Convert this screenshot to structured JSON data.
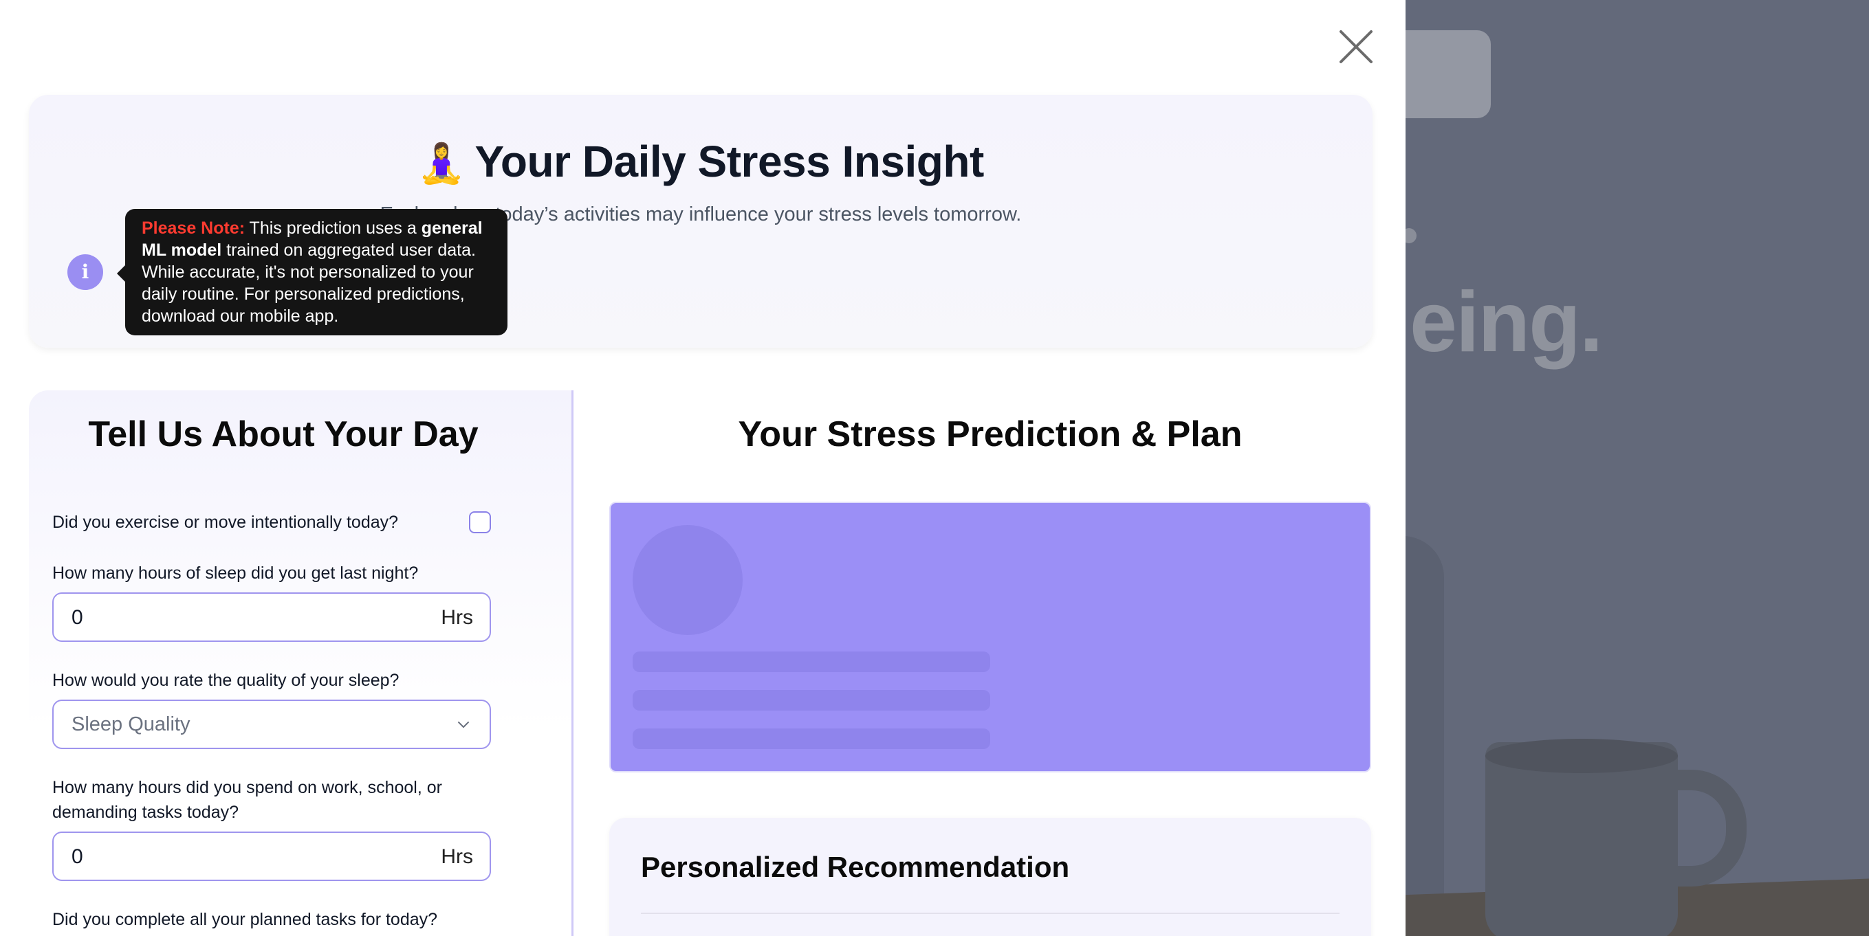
{
  "background": {
    "headline_fragment": "eing."
  },
  "modal": {
    "header": {
      "emoji": "🧘‍♀️",
      "title": "Your Daily Stress Insight",
      "subtitle": "Explore how today’s activities may influence your stress levels tomorrow."
    },
    "tooltip": {
      "note_label": "Please Note:",
      "text_before": " This prediction uses a ",
      "bold_text": "general ML model",
      "text_after": " trained on aggregated user data. While accurate, it's not personalized to your daily routine. For personalized predictions, download our mobile app."
    },
    "form": {
      "title": "Tell Us About Your Day",
      "exercise_question": "Did you exercise or move intentionally today?",
      "sleep_hours_question": "How many hours of sleep did you get last night?",
      "sleep_hours_value": "0",
      "sleep_hours_unit": "Hrs",
      "sleep_quality_question": "How would you rate the quality of your sleep?",
      "sleep_quality_placeholder": "Sleep Quality",
      "work_hours_question": "How many hours did you spend on work, school, or demanding tasks today?",
      "work_hours_value": "0",
      "work_hours_unit": "Hrs",
      "tasks_question": "Did you complete all your planned tasks for today?"
    },
    "prediction": {
      "title": "Your Stress Prediction & Plan",
      "recommendation_title": "Personalized Recommendation"
    }
  },
  "colors": {
    "accent": "#9b8ff6",
    "tooltip_bg": "#141414",
    "note_red": "#ff3b30"
  }
}
